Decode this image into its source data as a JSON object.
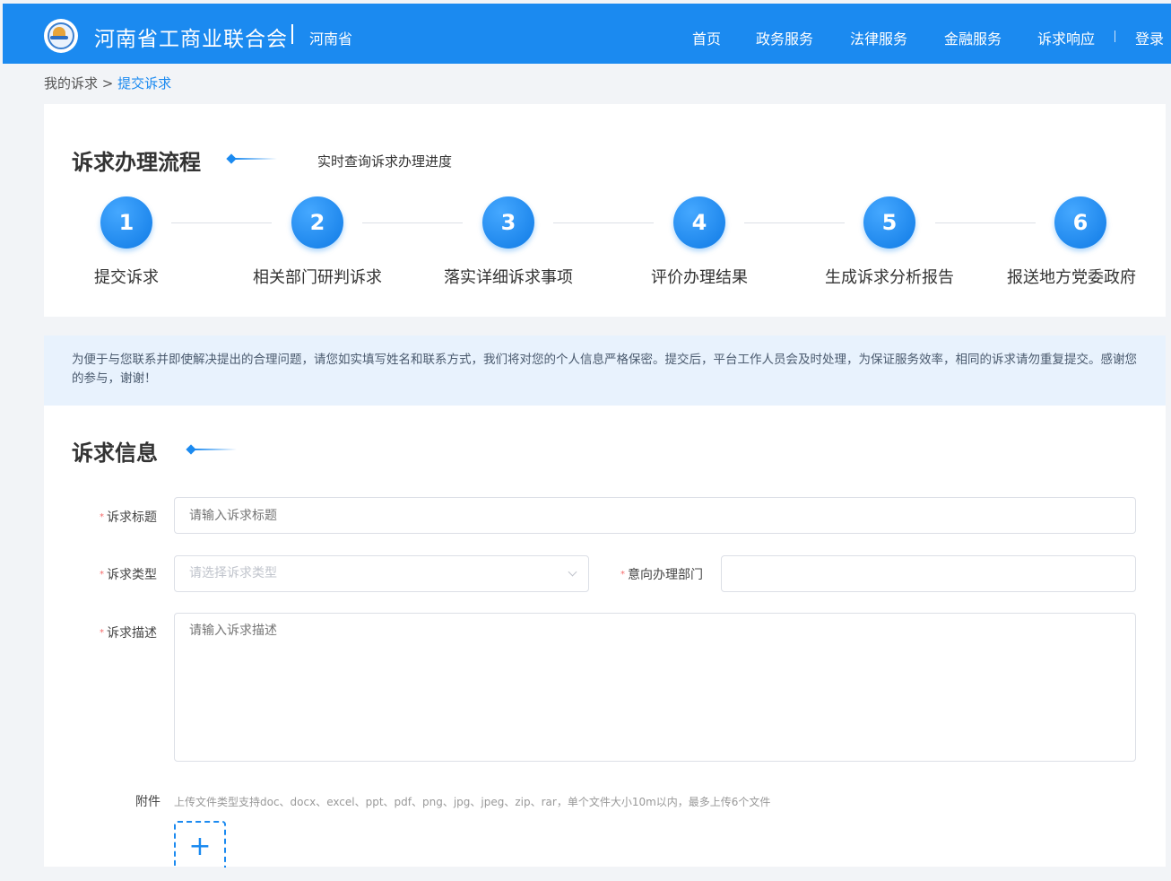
{
  "header": {
    "title": "河南省工商业联合会",
    "region": "河南省",
    "nav": [
      "首页",
      "政务服务",
      "法律服务",
      "金融服务",
      "诉求响应"
    ],
    "login": "登录",
    "logo_icon": "federation-emblem-icon"
  },
  "breadcrumb": {
    "parent": "我的诉求",
    "separator": ">",
    "current": "提交诉求"
  },
  "process": {
    "title": "诉求办理流程",
    "subtitle": "实时查询诉求办理进度",
    "steps": [
      {
        "num": "1",
        "label": "提交诉求"
      },
      {
        "num": "2",
        "label": "相关部门研判诉求"
      },
      {
        "num": "3",
        "label": "落实详细诉求事项"
      },
      {
        "num": "4",
        "label": "评价办理结果"
      },
      {
        "num": "5",
        "label": "生成诉求分析报告"
      },
      {
        "num": "6",
        "label": "报送地方党委政府"
      }
    ]
  },
  "notice": "为便于与您联系并即使解决提出的合理问题，请您如实填写姓名和联系方式，我们将对您的个人信息严格保密。提交后，平台工作人员会及时处理，为保证服务效率，相同的诉求请勿重复提交。感谢您的参与，谢谢！",
  "form": {
    "title": "诉求信息",
    "required_mark": "*",
    "fields": {
      "title_label": "诉求标题",
      "title_placeholder": "请输入诉求标题",
      "type_label": "诉求类型",
      "type_placeholder": "请选择诉求类型",
      "dept_label": "意向办理部门",
      "dept_value": "",
      "desc_label": "诉求描述",
      "desc_placeholder": "请输入诉求描述",
      "attach_label": "附件",
      "attach_hint": "上传文件类型支持doc、docx、excel、ppt、pdf、png、jpg、jpeg、zip、rar，单个文件大小10m以内，最多上传6个文件",
      "upload_icon": "+"
    }
  },
  "colors": {
    "primary": "#1b8af0",
    "notice_bg": "#e8f2fd",
    "required": "#f56c6c"
  }
}
